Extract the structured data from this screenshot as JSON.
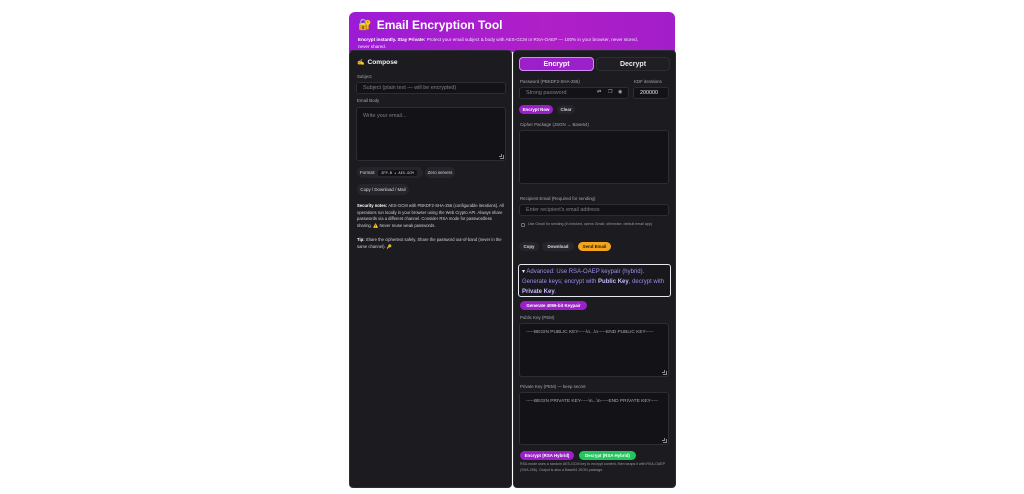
{
  "header": {
    "title": "Email Encryption Tool",
    "lock_icon": "lock-key-icon",
    "tagline_strong": "Encrypt instantly. Stay Private:",
    "tagline_rest": " Protect your email subject & body with AES-GCM or RSA-OAEP — 100% in your browser, never stored, never shared."
  },
  "compose": {
    "title": "Compose",
    "subject_label": "Subject",
    "subject_placeholder": "Subject (plain text — will be encrypted)",
    "body_label": "Email Body",
    "body_placeholder": "Write your email...",
    "format_label": "Format:",
    "format_value": "ZFP-B + AES-GCM",
    "zero_servers": "Zero servers",
    "copy_download_mail": "Copy / Download / Mail",
    "security_strong": "Security notes:",
    "security_text": " AES-GCM with PBKDF2-SHA-256 (configurable iterations). All operations run locally in your browser using the Web Crypto API. Always share passwords via a different channel. Consider RSA mode for passwordless sharing. ⚠️ Never reuse weak passwords.",
    "tip_strong": "Tip:",
    "tip_text": " Share the ciphertext safely. Share the password out-of-band (never in the same channel). 🔑"
  },
  "tabs": {
    "encrypt": "Encrypt",
    "decrypt": "Decrypt"
  },
  "encrypt": {
    "password_label": "Password (PBKDF2-SHA-256)",
    "password_placeholder": "Strong password",
    "kdf_label": "KDF iterations",
    "kdf_value": "200000",
    "encrypt_now": "Encrypt Now",
    "clear": "Clear",
    "cipher_label": "Cipher Package (JSON → Base64)",
    "recipient_label": "Recipient Email (Required for sending)",
    "recipient_placeholder": "Enter recipient's email address",
    "gmail_option": "Use Gmail for sending (if checked, opens Gmail; otherwise, default email app)",
    "copy": "Copy",
    "download": "Download",
    "send_email": "Send Email"
  },
  "advanced": {
    "summary_1": "Advanced: Use RSA-OAEP keypair (hybrid).",
    "summary_2": "Generate keys; encrypt with ",
    "public_key_bold": "Public Key",
    "summary_3": ", decrypt with ",
    "private_key_bold": "Private Key",
    "summary_end": ".",
    "generate_button": "Generate 4096-bit Keypair",
    "public_label": "Public Key (PEM)",
    "public_value": "-----BEGIN PUBLIC KEY-----\\n...\\n-----END PUBLIC KEY-----",
    "private_label": "Private Key (PEM) — keep secret",
    "private_value": "-----BEGIN PRIVATE KEY-----\\n...\\n-----END PRIVATE KEY-----",
    "encrypt_rsa": "Encrypt (RSA Hybrid)",
    "decrypt_rsa": "Decrypt (RSA Hybrid)",
    "rsa_note": "RSA mode uses a random AES-GCM key to encrypt content, then wraps it with RSA-OAEP (SHA-256). Output is also a Base64 JSON package."
  },
  "colors": {
    "brand": "#9d1bd6",
    "panel": "#1b1b20",
    "accent_orange": "#f4a51c",
    "accent_green": "#22c55e"
  }
}
